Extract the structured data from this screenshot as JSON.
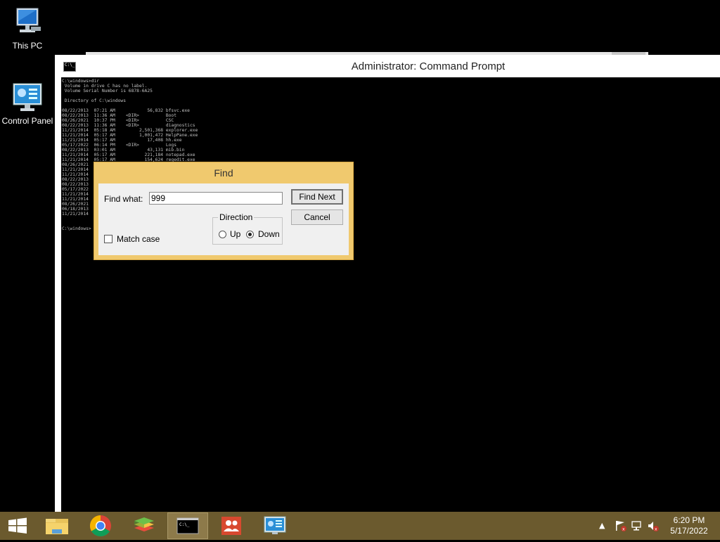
{
  "desktop": {
    "icons": [
      {
        "label": "This PC",
        "icon": "computer-icon"
      },
      {
        "label": "Control Panel",
        "icon": "control-panel-icon"
      }
    ]
  },
  "cmd": {
    "title": "Administrator: Command Prompt",
    "title_icon_text": "C:\\_",
    "console_lines": [
      "C:\\windows>dir",
      " Volume in drive C has no label.",
      " Volume Serial Number is 6878-6A25",
      "",
      " Directory of C:\\windows",
      "",
      "08/22/2013  07:21 AM            56,832 bfsvc.exe",
      "08/22/2013  11:36 AM    <DIR>          Boot",
      "08/26/2021  10:37 PM    <DIR>          CSC",
      "08/22/2013  11:36 AM    <DIR>          diagnostics",
      "11/21/2014  05:18 AM         2,501,368 explorer.exe",
      "11/21/2014  05:17 AM         1,001,472 HelpPane.exe",
      "11/21/2014  05:17 AM            17,408 hh.exe",
      "05/17/2022  06:14 PM    <DIR>          Logs",
      "08/22/2013  03:01 AM            43,131 mib.bin",
      "11/21/2014  05:17 AM           221,184 notepad.exe",
      "11/21/2014  05:17 AM           154,624 regedit.exe",
      "08/26/2021",
      "11/21/2014",
      "11/21/2014",
      "08/22/2013",
      "08/22/2013",
      "05/17/2022",
      "11/21/2014",
      "11/21/2014",
      "08/26/2021",
      "06/18/2013",
      "11/21/2014",
      "",
      "",
      "C:\\windows>"
    ]
  },
  "find": {
    "title": "Find",
    "find_what_label": "Find what:",
    "find_what_value": "999",
    "find_next_label": "Find Next",
    "cancel_label": "Cancel",
    "direction_label": "Direction",
    "up_label": "Up",
    "down_label": "Down",
    "direction_selected": "Down",
    "match_case_label": "Match case",
    "match_case_checked": false
  },
  "taskbar": {
    "items": [
      "start-button",
      "file-explorer",
      "chrome",
      "bluestacks",
      "command-prompt",
      "people-app",
      "control-panel"
    ],
    "active_item": "command-prompt",
    "clock_time": "6:20 PM",
    "clock_date": "5/17/2022",
    "tray_icons": [
      "show-hidden-icons-arrow",
      "action-center-flag-icon",
      "network-icon",
      "volume-muted-icon"
    ]
  },
  "colors": {
    "desktop": "#000000",
    "taskbar": "#6b5a2e",
    "dialog_frame": "#f0c96e",
    "dialog_body": "#f0f0f0"
  }
}
